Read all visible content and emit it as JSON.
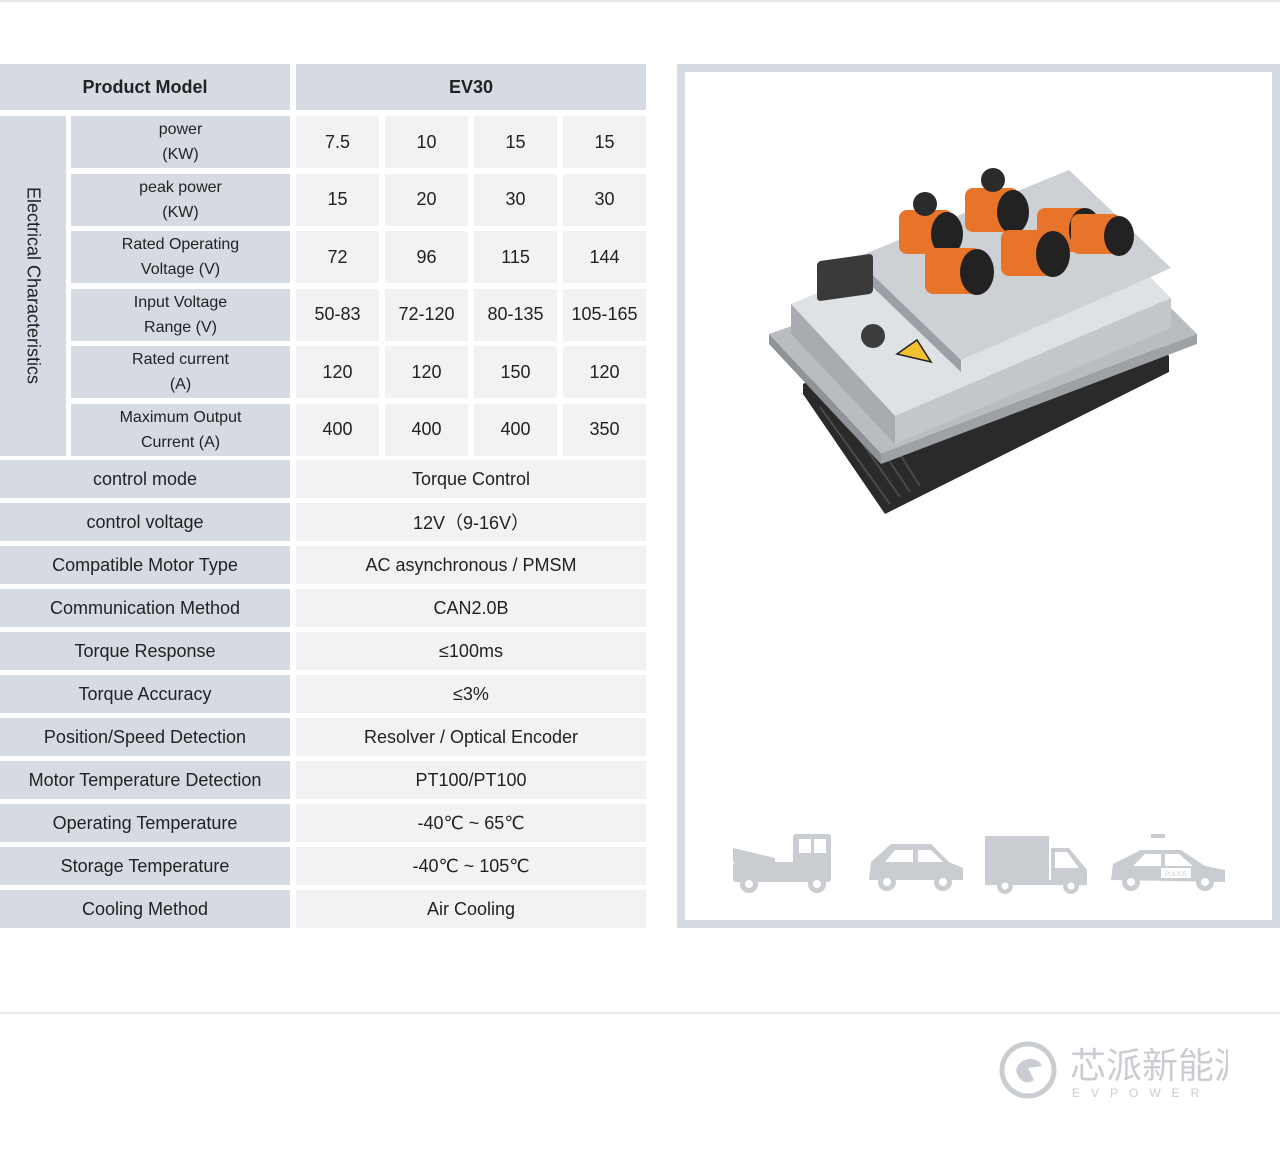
{
  "table": {
    "header": {
      "label": "Product Model",
      "model": "EV30"
    },
    "group_label": "Electrical Characteristics",
    "electrical_rows": [
      {
        "line1": "power",
        "line2": "(KW)",
        "values": [
          "7.5",
          "10",
          "15",
          "15"
        ]
      },
      {
        "line1": "peak power",
        "line2": "(KW)",
        "values": [
          "15",
          "20",
          "30",
          "30"
        ]
      },
      {
        "line1": "Rated Operating",
        "line2": "Voltage (V)",
        "values": [
          "72",
          "96",
          "115",
          "144"
        ]
      },
      {
        "line1": "Input Voltage",
        "line2": "Range (V)",
        "values": [
          "50-83",
          "72-120",
          "80-135",
          "105-165"
        ]
      },
      {
        "line1": "Rated current",
        "line2": "(A)",
        "values": [
          "120",
          "120",
          "150",
          "120"
        ]
      },
      {
        "line1": "Maximum Output",
        "line2": "Current (A)",
        "values": [
          "400",
          "400",
          "400",
          "350"
        ]
      }
    ],
    "spec_rows": [
      {
        "label": "control mode",
        "value": "Torque Control"
      },
      {
        "label": "control voltage",
        "value": "12V（9-16V）"
      },
      {
        "label": "Compatible Motor Type",
        "value": "AC asynchronous  /  PMSM"
      },
      {
        "label": "Communication Method",
        "value": "CAN2.0B"
      },
      {
        "label": "Torque Response",
        "value": "≤100ms"
      },
      {
        "label": "Torque Accuracy",
        "value": "≤3%"
      },
      {
        "label": "Position/Speed Detection",
        "value": "Resolver / Optical Encoder"
      },
      {
        "label": "Motor Temperature Detection",
        "value": "PT100/PT100"
      },
      {
        "label": "Operating Temperature",
        "value": "-40℃ ~ 65℃"
      },
      {
        "label": "Storage Temperature",
        "value": "-40℃ ~ 105℃"
      },
      {
        "label": "Cooling Method",
        "value": "Air Cooling"
      }
    ]
  },
  "product_image": {
    "connector_label": ""
  },
  "vehicle_icons": [
    "utility-cart-icon",
    "hatchback-car-icon",
    "delivery-truck-icon",
    "police-car-icon"
  ],
  "police_text": "POLICE",
  "logo": {
    "chinese": "芯派新能源",
    "english": "EVPOWER"
  },
  "colors": {
    "header_bg": "#d6dbe3",
    "value_bg": "#f1f2f4",
    "accent_orange": "#e8742a",
    "icon_gray": "#c9ccd0"
  }
}
